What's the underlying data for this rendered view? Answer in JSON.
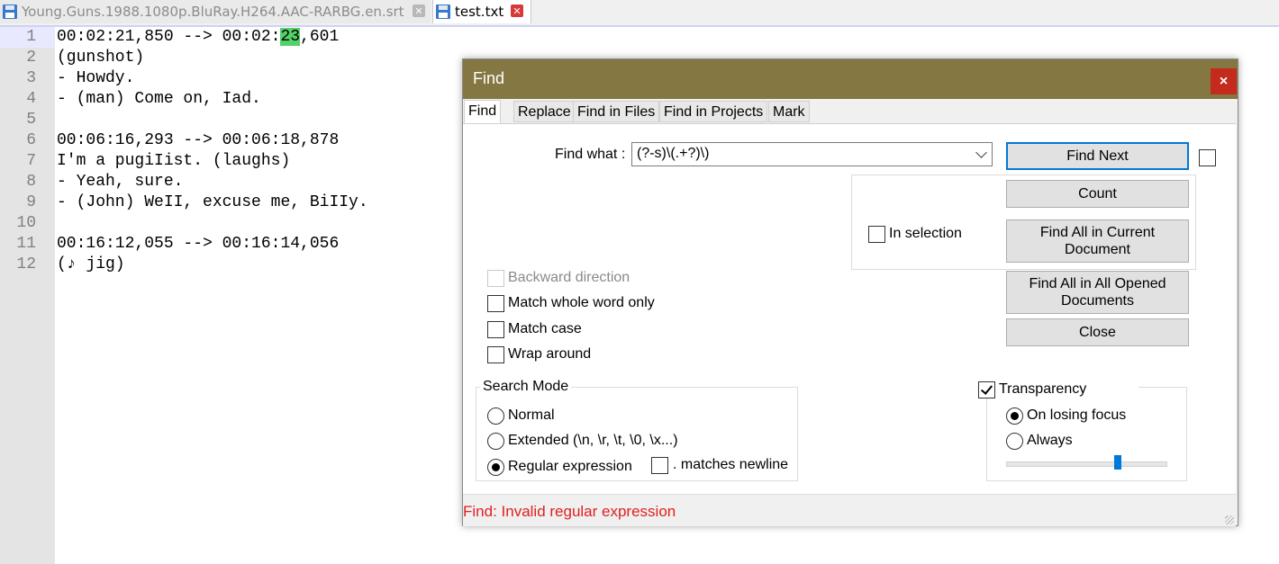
{
  "tabs": [
    {
      "label": "Young.Guns.1988.1080p.BluRay.H264.AAC-RARBG.en.srt",
      "icon": "floppy-disk-icon",
      "active": false
    },
    {
      "label": "test.txt",
      "icon": "floppy-disk-icon",
      "active": true
    }
  ],
  "editor": {
    "line_numbers": [
      "1",
      "2",
      "3",
      "4",
      "5",
      "6",
      "7",
      "8",
      "9",
      "10",
      "11",
      "12"
    ],
    "lines": [
      {
        "before": "00:02:21,850 --> 00:02:",
        "match": "23",
        "after": ",601"
      },
      {
        "text": "(gunshot)"
      },
      {
        "text": "- Howdy."
      },
      {
        "text": "- (man) Come on, Iad."
      },
      {
        "text": ""
      },
      {
        "text": "00:06:16,293 --> 00:06:18,878"
      },
      {
        "text": "I'm a pugiIist. (laughs)"
      },
      {
        "text": "- Yeah, sure."
      },
      {
        "text": "- (John) WeII, excuse me, BiIIy."
      },
      {
        "text": ""
      },
      {
        "text": "00:16:12,055 --> 00:16:14,056"
      },
      {
        "text": "(♪ jig)"
      }
    ]
  },
  "dialog": {
    "title": "Find",
    "close_label": "×",
    "tabs": [
      "Find",
      "Replace",
      "Find in Files",
      "Find in Projects",
      "Mark"
    ],
    "find_what_label": "Find what :",
    "find_what_value": "(?-s)\\(.+?)\\)",
    "buttons": {
      "find_next": "Find Next",
      "count": "Count",
      "find_all_current": "Find All in Current Document",
      "find_all_opened": "Find All in All Opened Documents",
      "close": "Close"
    },
    "in_selection": "In selection",
    "options": {
      "backward": "Backward direction",
      "whole_word": "Match whole word only",
      "match_case": "Match case",
      "wrap_around": "Wrap around"
    },
    "search_mode": {
      "title": "Search Mode",
      "normal": "Normal",
      "extended": "Extended (\\n, \\r, \\t, \\0, \\x...)",
      "regex": "Regular expression",
      "dot_newline": ". matches newline",
      "selected": "regex"
    },
    "transparency": {
      "label": "Transparency",
      "checked": true,
      "on_losing_focus": "On losing focus",
      "always": "Always",
      "selected": "on_losing_focus",
      "slider_level": 0.72
    },
    "status": "Find: Invalid regular expression"
  },
  "colors": {
    "title_bar": "#857742",
    "close_button": "#c42b1c",
    "status_error": "#e02020",
    "match_highlight": "#54d169",
    "current_line": "#e8e8ff"
  }
}
